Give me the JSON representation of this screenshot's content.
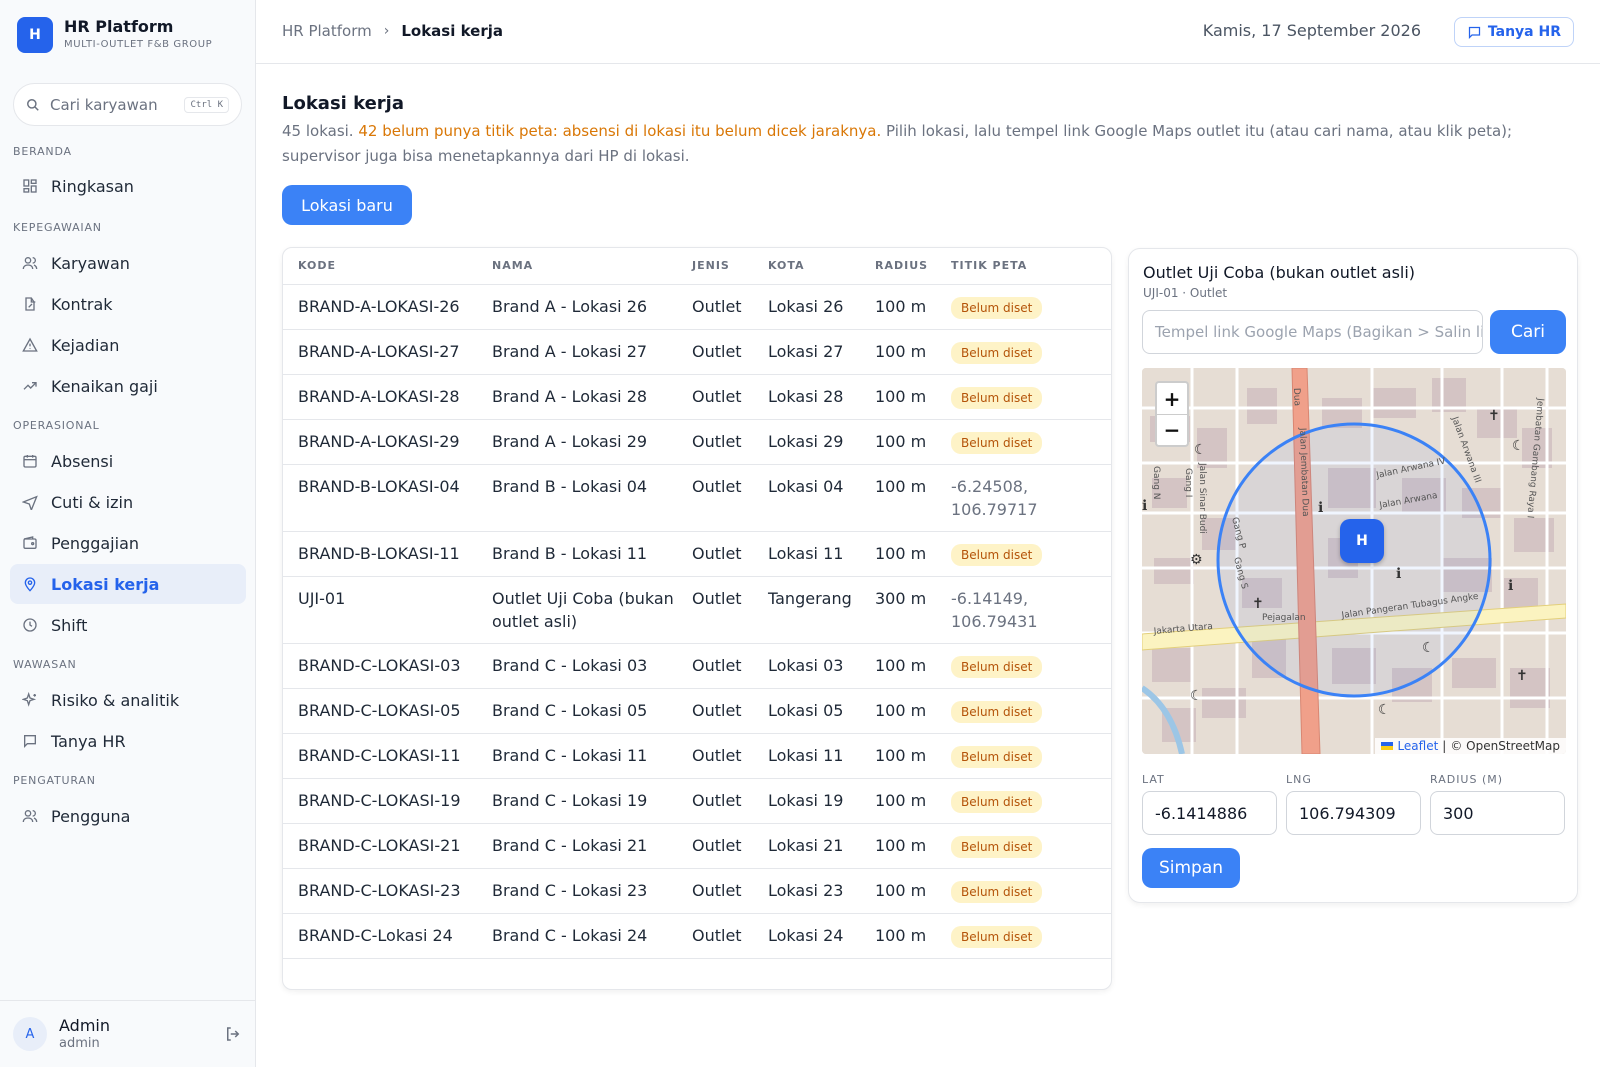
{
  "brand": {
    "logo": "H",
    "title": "HR Platform",
    "subtitle": "MULTI-OUTLET F&B GROUP"
  },
  "search": {
    "placeholder": "Cari karyawan",
    "shortcut": "Ctrl K"
  },
  "nav": {
    "sections": [
      {
        "label": "BERANDA"
      },
      {
        "label": "KEPEGAWAIAN"
      },
      {
        "label": "OPERASIONAL"
      },
      {
        "label": "WAWASAN"
      },
      {
        "label": "PENGATURAN"
      }
    ],
    "items": [
      {
        "label": "Ringkasan",
        "icon": "grid-icon"
      },
      {
        "label": "Karyawan",
        "icon": "users-icon"
      },
      {
        "label": "Kontrak",
        "icon": "file-edit-icon"
      },
      {
        "label": "Kejadian",
        "icon": "alert-triangle-icon"
      },
      {
        "label": "Kenaikan gaji",
        "icon": "trending-up-icon"
      },
      {
        "label": "Absensi",
        "icon": "calendar-check-icon"
      },
      {
        "label": "Cuti & izin",
        "icon": "plane-icon"
      },
      {
        "label": "Penggajian",
        "icon": "wallet-icon"
      },
      {
        "label": "Lokasi kerja",
        "icon": "map-pin-icon"
      },
      {
        "label": "Shift",
        "icon": "clock-icon"
      },
      {
        "label": "Risiko & analitik",
        "icon": "sparkles-icon"
      },
      {
        "label": "Tanya HR",
        "icon": "message-square-icon"
      },
      {
        "label": "Pengguna",
        "icon": "users-icon"
      }
    ],
    "active": "Lokasi kerja"
  },
  "user": {
    "initial": "A",
    "name": "Admin",
    "role": "admin"
  },
  "breadcrumb": {
    "root": "HR Platform",
    "separator": "›",
    "current": "Lokasi kerja"
  },
  "header": {
    "date": "Kamis, 17 September 2026",
    "ask_label": "Tanya HR"
  },
  "page": {
    "title": "Lokasi kerja",
    "count_text": "45 lokasi.",
    "warning_text": "42 belum punya titik peta: absensi di lokasi itu belum dicek jaraknya.",
    "help_text": "Pilih lokasi, lalu tempel link Google Maps outlet itu (atau cari nama, atau klik peta); supervisor juga bisa menetapkannya dari HP di lokasi.",
    "new_button": "Lokasi baru"
  },
  "table": {
    "headers": [
      "KODE",
      "NAMA",
      "JENIS",
      "KOTA",
      "RADIUS",
      "TITIK PETA"
    ],
    "rows": [
      {
        "code": "BRAND-A-LOKASI-26",
        "name": "Brand A - Lokasi 26",
        "type": "Outlet",
        "city": "Lokasi 26",
        "radius": "100 m",
        "point": "Belum diset",
        "is_set": false
      },
      {
        "code": "BRAND-A-LOKASI-27",
        "name": "Brand A - Lokasi 27",
        "type": "Outlet",
        "city": "Lokasi 27",
        "radius": "100 m",
        "point": "Belum diset",
        "is_set": false
      },
      {
        "code": "BRAND-A-LOKASI-28",
        "name": "Brand A - Lokasi 28",
        "type": "Outlet",
        "city": "Lokasi 28",
        "radius": "100 m",
        "point": "Belum diset",
        "is_set": false
      },
      {
        "code": "BRAND-A-LOKASI-29",
        "name": "Brand A - Lokasi 29",
        "type": "Outlet",
        "city": "Lokasi 29",
        "radius": "100 m",
        "point": "Belum diset",
        "is_set": false
      },
      {
        "code": "BRAND-B-LOKASI-04",
        "name": "Brand B - Lokasi 04",
        "type": "Outlet",
        "city": "Lokasi 04",
        "radius": "100 m",
        "point": "-6.24508, 106.79717",
        "is_set": true
      },
      {
        "code": "BRAND-B-LOKASI-11",
        "name": "Brand B - Lokasi 11",
        "type": "Outlet",
        "city": "Lokasi 11",
        "radius": "100 m",
        "point": "Belum diset",
        "is_set": false
      },
      {
        "code": "UJI-01",
        "name": "Outlet Uji Coba (bukan outlet asli)",
        "type": "Outlet",
        "city": "Tangerang",
        "radius": "300 m",
        "point": "-6.14149, 106.79431",
        "is_set": true
      },
      {
        "code": "BRAND-C-LOKASI-03",
        "name": "Brand C - Lokasi 03",
        "type": "Outlet",
        "city": "Lokasi 03",
        "radius": "100 m",
        "point": "Belum diset",
        "is_set": false
      },
      {
        "code": "BRAND-C-LOKASI-05",
        "name": "Brand C - Lokasi 05",
        "type": "Outlet",
        "city": "Lokasi 05",
        "radius": "100 m",
        "point": "Belum diset",
        "is_set": false
      },
      {
        "code": "BRAND-C-LOKASI-11",
        "name": "Brand C - Lokasi 11",
        "type": "Outlet",
        "city": "Lokasi 11",
        "radius": "100 m",
        "point": "Belum diset",
        "is_set": false
      },
      {
        "code": "BRAND-C-LOKASI-19",
        "name": "Brand C - Lokasi 19",
        "type": "Outlet",
        "city": "Lokasi 19",
        "radius": "100 m",
        "point": "Belum diset",
        "is_set": false
      },
      {
        "code": "BRAND-C-LOKASI-21",
        "name": "Brand C - Lokasi 21",
        "type": "Outlet",
        "city": "Lokasi 21",
        "radius": "100 m",
        "point": "Belum diset",
        "is_set": false
      },
      {
        "code": "BRAND-C-LOKASI-23",
        "name": "Brand C - Lokasi 23",
        "type": "Outlet",
        "city": "Lokasi 23",
        "radius": "100 m",
        "point": "Belum diset",
        "is_set": false
      },
      {
        "code": "BRAND-C-Lokasi 24",
        "name": "Brand C - Lokasi 24",
        "type": "Outlet",
        "city": "Lokasi 24",
        "radius": "100 m",
        "point": "Belum diset",
        "is_set": false
      }
    ]
  },
  "detail": {
    "title": "Outlet Uji Coba (bukan outlet asli)",
    "subtitle": "UJI-01 · Outlet",
    "gmaps_placeholder": "Tempel link Google Maps (Bagikan > Salin link)",
    "search_button": "Cari",
    "map": {
      "zoom_in": "+",
      "zoom_out": "−",
      "attribution_leaflet": "Leaflet",
      "attribution_sep": "|",
      "attribution_osm": "© OpenStreetMap",
      "marker_label": "H",
      "street_labels": [
        "Jalan Pangeran Tubagus Angke",
        "Jalan Jembatan Dua",
        "Jalan Arwana IV",
        "Jalan Arwana III",
        "Jalan Sinar Budi",
        "Gang P",
        "Gang S",
        "Gang I",
        "Pejagalan",
        "Jakarta Utara",
        "Jembatan Gambang Raya I",
        "Jalan Arwana",
        "Gang N",
        "Dua"
      ]
    },
    "lat_label": "LAT",
    "lat_value": "-6.1414886",
    "lng_label": "LNG",
    "lng_value": "106.794309",
    "radius_label": "RADIUS (M)",
    "radius_value": "300",
    "save_button": "Simpan"
  },
  "colors": {
    "accent": "#3b82f6",
    "warning": "#d97706",
    "badge_bg": "#fef3c7",
    "active_bg": "#e8eef9",
    "radius_circle": "#3b82f6",
    "main_road": "#f0a08a"
  }
}
